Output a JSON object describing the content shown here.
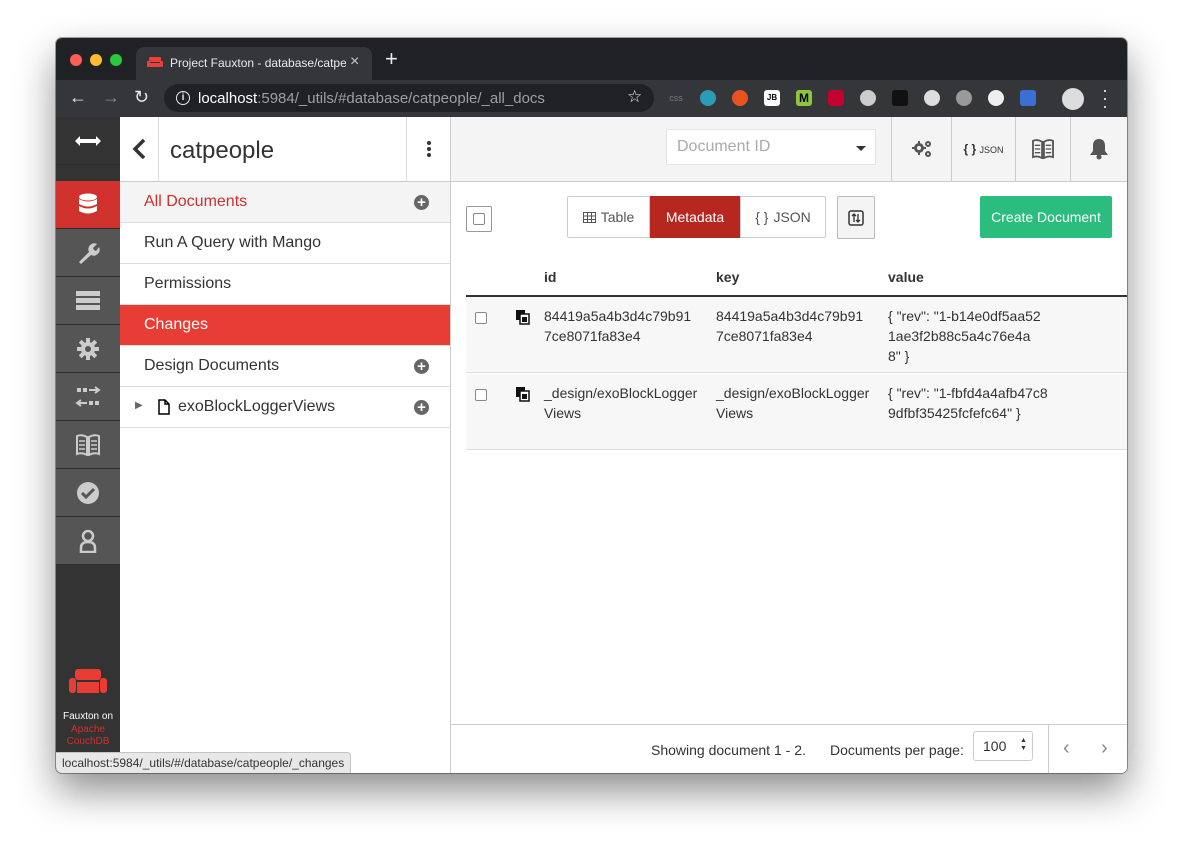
{
  "browser": {
    "tab_title": "Project Fauxton - database/catpeople/_all_docs",
    "url_host": "localhost",
    "url_rest": ":5984/_utils/#database/catpeople/_all_docs",
    "status_url": "localhost:5984/_utils/#/database/catpeople/_changes",
    "ext_labels": [
      "css",
      "JB",
      "M"
    ]
  },
  "appnav": {
    "brand_label": "Fauxton on",
    "brand_sub_1": "Apache",
    "brand_sub_2": "CouchDB",
    "accent_color": "#d0312c"
  },
  "sidebar": {
    "db_name": "catpeople",
    "items": [
      {
        "label": "All Documents"
      },
      {
        "label": "Run A Query with Mango"
      },
      {
        "label": "Permissions"
      },
      {
        "label": "Changes"
      },
      {
        "label": "Design Documents"
      },
      {
        "label": "exoBlockLoggerViews"
      }
    ]
  },
  "header": {
    "doc_id_placeholder": "Document ID",
    "json_label": "{ }",
    "json_label_small": "JSON"
  },
  "toolbar": {
    "views": [
      {
        "label": "Table",
        "icon": "table-icon"
      },
      {
        "label": "Metadata"
      },
      {
        "label": "JSON",
        "icon": "braces"
      }
    ],
    "create_label": "Create Document"
  },
  "table": {
    "columns": [
      "id",
      "key",
      "value"
    ],
    "rows": [
      {
        "id": "84419a5a4b3d4c79b917ce8071fa83e4",
        "key": "84419a5a4b3d4c79b917ce8071fa83e4",
        "value": "{ \"rev\": \"1-b14e0df5aa521ae3f2b88c5a4c76e4a8\" }"
      },
      {
        "id": "_design/exoBlockLoggerViews",
        "key": "_design/exoBlockLoggerViews",
        "value": "{ \"rev\": \"1-fbfd4a4afb47c89dfbf35425fcfefc64\" }"
      }
    ]
  },
  "footer": {
    "showing": "Showing document 1 - 2.",
    "per_page_label": "Documents per page:",
    "per_page_value": "100"
  }
}
